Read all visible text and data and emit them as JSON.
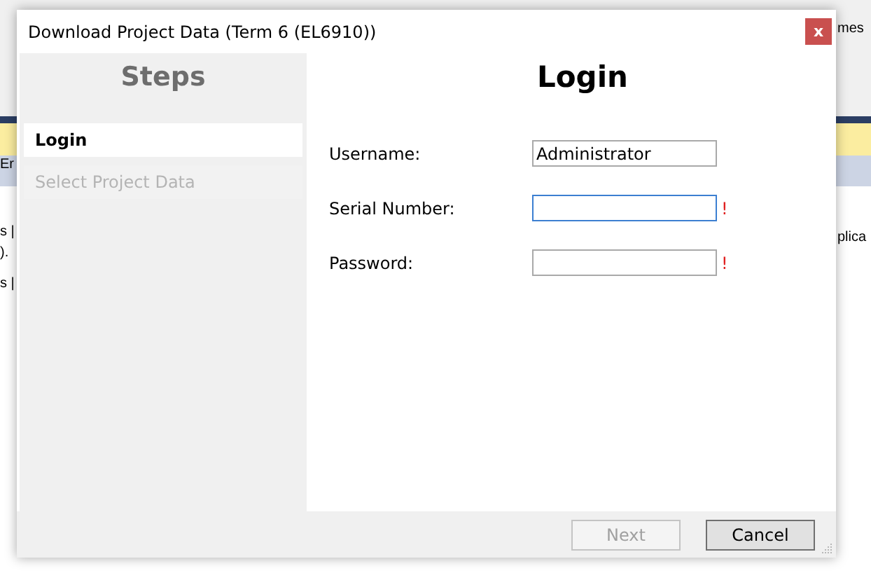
{
  "background_left": [
    "Er",
    "s |",
    ").",
    "s |"
  ],
  "background_right": [
    "mes",
    "plica"
  ],
  "window": {
    "title": "Download Project Data (Term 6 (EL6910))",
    "close": "x"
  },
  "steps": {
    "title": "Steps",
    "items": [
      {
        "label": "Login",
        "selected": true,
        "disabled": false
      },
      {
        "label": "Select Project Data",
        "selected": false,
        "disabled": true
      }
    ]
  },
  "page": {
    "title": "Login",
    "fields": [
      {
        "label": "Username:",
        "value": "Administrator",
        "focused": false
      },
      {
        "label": "Serial Number:",
        "focused": true,
        "error": "!"
      },
      {
        "label": "Password:",
        "focused": false,
        "error": "!"
      }
    ]
  },
  "buttons": [
    {
      "label": "Next",
      "disabled": true
    },
    {
      "label": "Cancel",
      "disabled": false
    }
  ]
}
